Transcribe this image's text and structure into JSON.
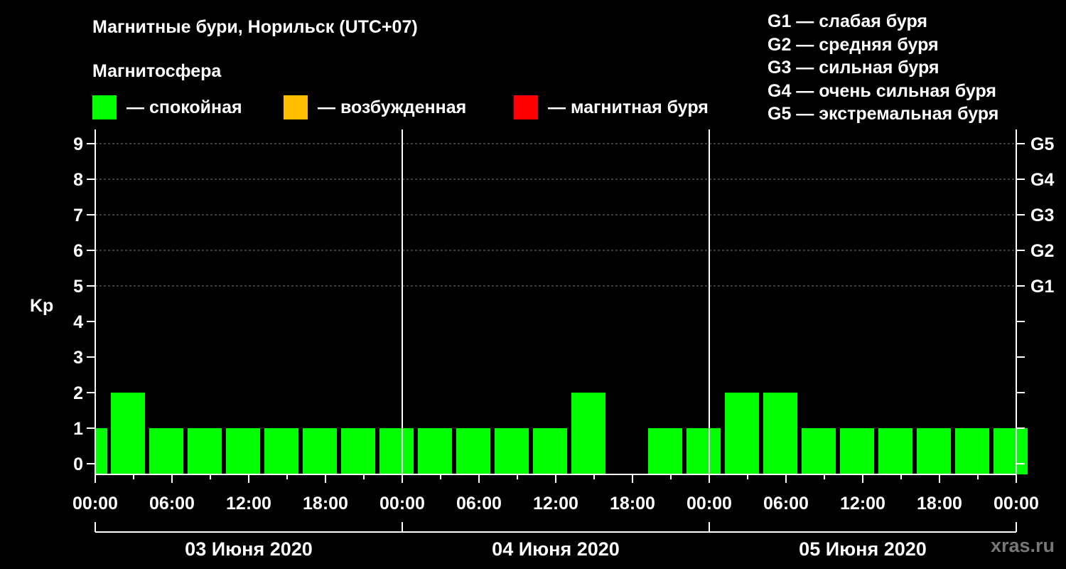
{
  "title": "Магнитные бури, Норильск (UTC+07)",
  "legend": {
    "heading": "Магнитосфера",
    "items": [
      {
        "label": "— спокойная",
        "color": "#00ff00"
      },
      {
        "label": "— возбужденная",
        "color": "#ffbf00"
      },
      {
        "label": "— магнитная буря",
        "color": "#ff0000"
      }
    ]
  },
  "storm_scale": [
    "G1 — слабая буря",
    "G2 — средняя буря",
    "G3 — сильная буря",
    "G4 — очень сильная буря",
    "G5 — экстремальная буря"
  ],
  "watermark": "xras.ru",
  "chart_data": {
    "type": "bar",
    "ylabel": "Kp",
    "ylim": [
      0,
      9
    ],
    "y_ticks": [
      "0",
      "1",
      "2",
      "3",
      "4",
      "5",
      "6",
      "7",
      "8",
      "9"
    ],
    "right_ticks": [
      {
        "kp": 5,
        "label": "G1"
      },
      {
        "kp": 6,
        "label": "G2"
      },
      {
        "kp": 7,
        "label": "G3"
      },
      {
        "kp": 8,
        "label": "G4"
      },
      {
        "kp": 9,
        "label": "G5"
      }
    ],
    "x_tick_labels": [
      "00:00",
      "06:00",
      "12:00",
      "18:00",
      "00:00",
      "06:00",
      "12:00",
      "18:00",
      "00:00",
      "06:00",
      "12:00",
      "18:00",
      "00:00"
    ],
    "days": [
      "03 Июня 2020",
      "04 Июня 2020",
      "05 Июня 2020"
    ],
    "grid": "dashed horizontal at Kp 5-9",
    "bar_color": "#00ff00",
    "values": [
      1,
      2,
      1,
      1,
      1,
      1,
      1,
      1,
      1,
      1,
      1,
      1,
      1,
      2,
      null,
      1,
      1,
      2,
      2,
      1,
      1,
      1,
      1,
      1,
      1
    ],
    "note_first_bar": "partial 3-hour interval at start"
  }
}
